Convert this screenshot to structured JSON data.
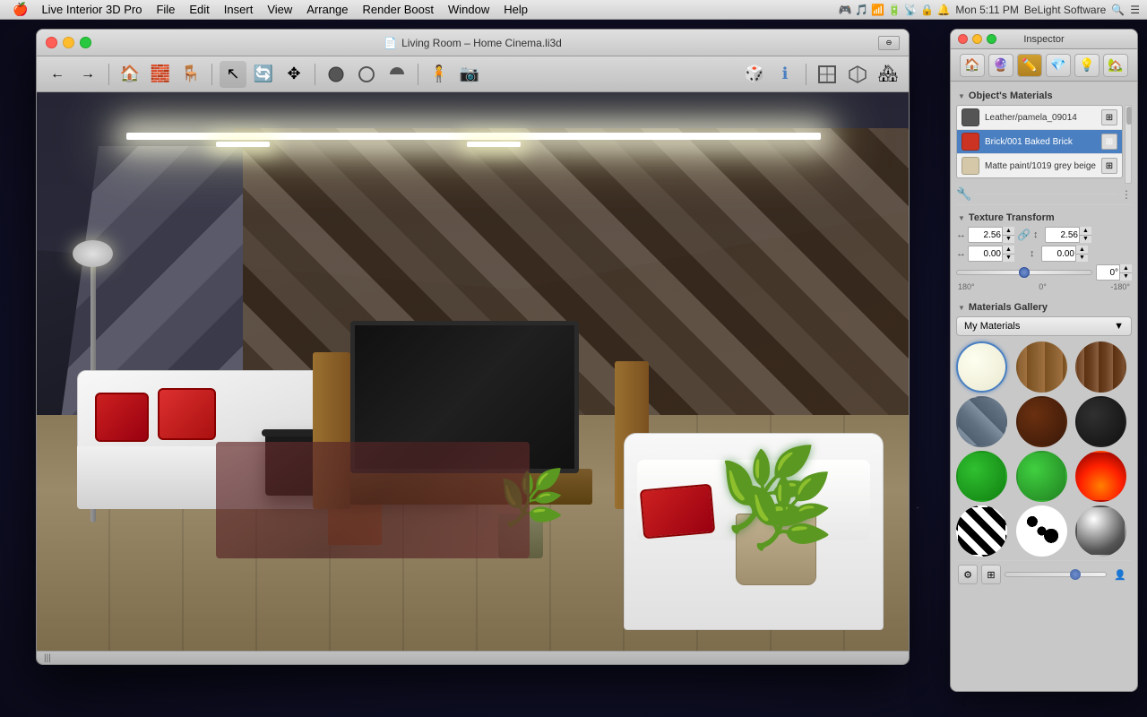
{
  "menubar": {
    "apple": "🍎",
    "items": [
      "Live Interior 3D Pro",
      "File",
      "Edit",
      "Insert",
      "View",
      "Arrange",
      "Render Boost",
      "Window",
      "Help"
    ],
    "right": {
      "time": "Mon 5:11 PM",
      "company": "BeLight Software"
    }
  },
  "window": {
    "title": "Living Room – Home Cinema.li3d",
    "traffic_lights": {
      "close": "close",
      "minimize": "minimize",
      "maximize": "maximize"
    }
  },
  "toolbar": {
    "nav_back": "←",
    "nav_forward": "→",
    "tool_floor": "floor",
    "tool_wall": "wall",
    "tool_furniture": "furniture",
    "mode_select": "▶",
    "mode_orbit": "orbit",
    "mode_pan": "pan",
    "mode_sphere": "sphere",
    "mode_circle": "circle",
    "mode_gear": "gear",
    "mode_camera": "camera",
    "view_info": "ℹ",
    "view_ortho": "ortho",
    "view_3d": "3d",
    "view_exterior": "exterior"
  },
  "inspector": {
    "title": "Inspector",
    "tabs": [
      "🏠",
      "🔮",
      "✏️",
      "💎",
      "💡",
      "🏡"
    ],
    "active_tab_index": 2,
    "sections": {
      "objects_materials": {
        "label": "Object's Materials",
        "materials": [
          {
            "name": "Leather/pamela_09014",
            "color": "#555555"
          },
          {
            "name": "Brick/001 Baked Brick",
            "color": "#cc3322"
          },
          {
            "name": "Matte paint/1019 grey beige",
            "color": "#d4c8a8"
          }
        ]
      },
      "texture_transform": {
        "label": "Texture Transform",
        "h_scale": "2.56",
        "v_scale": "2.56",
        "h_offset": "0.00",
        "v_offset": "0.00",
        "rotation": "0°",
        "rotation_min": "180°",
        "rotation_zero": "0°",
        "rotation_max": "-180°"
      },
      "materials_gallery": {
        "label": "Materials Gallery",
        "dropdown_label": "My Materials",
        "swatches": [
          {
            "id": "ivory",
            "type": "swatch-ivory",
            "selected": true
          },
          {
            "id": "wood1",
            "type": "swatch-wood1",
            "selected": false
          },
          {
            "id": "wood2",
            "type": "swatch-wood2",
            "selected": false
          },
          {
            "id": "metal",
            "type": "swatch-metal",
            "selected": false
          },
          {
            "id": "brown",
            "type": "swatch-brown",
            "selected": false
          },
          {
            "id": "black",
            "type": "swatch-black",
            "selected": false
          },
          {
            "id": "green",
            "type": "swatch-green",
            "selected": false
          },
          {
            "id": "green2",
            "type": "swatch-green2",
            "selected": false
          },
          {
            "id": "fire",
            "type": "swatch-fire",
            "selected": false
          },
          {
            "id": "zebra",
            "type": "swatch-zebra",
            "selected": false
          },
          {
            "id": "spots",
            "type": "swatch-spots",
            "selected": false
          },
          {
            "id": "chrome",
            "type": "swatch-chrome",
            "selected": false
          }
        ]
      }
    }
  },
  "statusbar": {
    "scroll_indicator": "|||"
  }
}
